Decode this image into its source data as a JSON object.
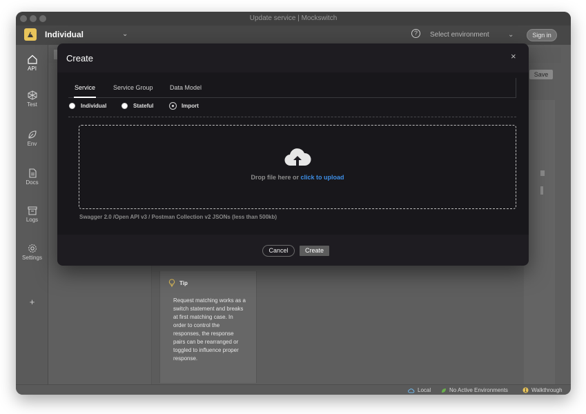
{
  "window": {
    "title": "Update service | Mockswitch"
  },
  "appbar": {
    "workspace": "Individual",
    "environment_placeholder": "Select environment",
    "sign_in": "Sign in"
  },
  "sidebar": {
    "items": [
      {
        "label": "API",
        "icon": "home-icon"
      },
      {
        "label": "Test",
        "icon": "cube-icon"
      },
      {
        "label": "Env",
        "icon": "leaf-icon"
      },
      {
        "label": "Docs",
        "icon": "document-icon"
      },
      {
        "label": "Logs",
        "icon": "archive-icon"
      },
      {
        "label": "Settings",
        "icon": "gear-icon"
      }
    ],
    "add": "+"
  },
  "background": {
    "save": "Save",
    "tip_title": "Tip",
    "tip_text": "Request matching works as a switch statement and breaks at first matching case. In order to control the responses, the response pairs can be rearranged or toggled to influence proper response."
  },
  "statusbar": {
    "local": "Local",
    "environments": "No Active Environments",
    "walkthrough": "Walkthrough"
  },
  "modal": {
    "title": "Create",
    "close": "×",
    "tabs": [
      "Service",
      "Service Group",
      "Data Model"
    ],
    "active_tab": "Service",
    "radio_options": [
      "Individual",
      "Stateful",
      "Import"
    ],
    "selected_radio": "Import",
    "dropzone": {
      "text": "Drop file here or",
      "link": "click to upload",
      "hint": "Swagger 2.0 /Open API v3 / Postman Collection v2 JSONs (less than 500kb)"
    },
    "cancel": "Cancel",
    "create": "Create"
  },
  "colors": {
    "modal_bg": "#1e1c21",
    "link": "#3d8ee6",
    "logo": "#e8c45a"
  }
}
